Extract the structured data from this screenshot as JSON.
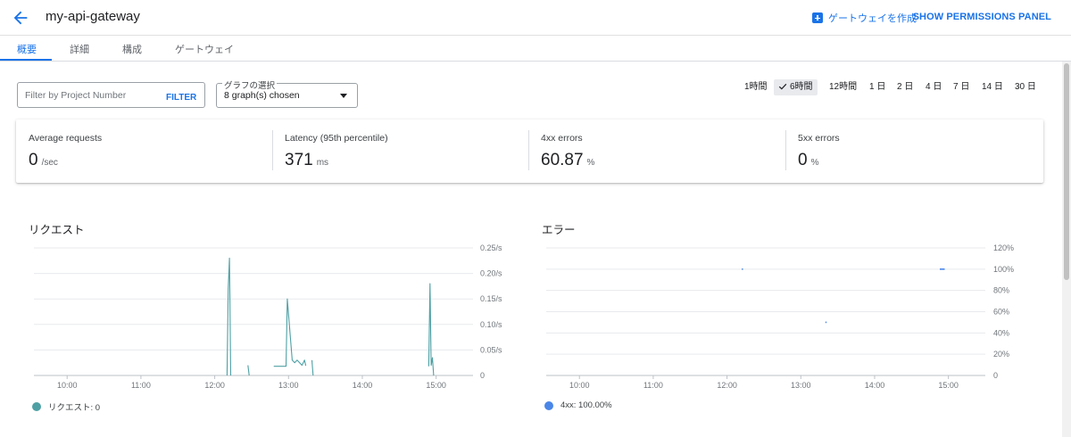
{
  "header": {
    "title": "my-api-gateway",
    "create_label": "ゲートウェイを作成",
    "permissions_label": "SHOW PERMISSIONS PANEL"
  },
  "tabs": [
    {
      "label": "概要"
    },
    {
      "label": "詳細"
    },
    {
      "label": "構成"
    },
    {
      "label": "ゲートウェイ"
    }
  ],
  "filter": {
    "placeholder": "Filter by Project Number",
    "button": "FILTER"
  },
  "graph_select": {
    "legend": "グラフの選択",
    "value": "8 graph(s) chosen"
  },
  "time_ranges": [
    {
      "label": "1時間",
      "selected": false
    },
    {
      "label": "6時間",
      "selected": true
    },
    {
      "label": "12時間",
      "selected": false
    },
    {
      "label": "1 日",
      "selected": false
    },
    {
      "label": "2 日",
      "selected": false
    },
    {
      "label": "4 日",
      "selected": false
    },
    {
      "label": "7 日",
      "selected": false
    },
    {
      "label": "14 日",
      "selected": false
    },
    {
      "label": "30 日",
      "selected": false
    }
  ],
  "metrics": [
    {
      "label": "Average requests",
      "value": "0",
      "unit": "/sec"
    },
    {
      "label": "Latency (95th percentile)",
      "value": "371",
      "unit": "ms"
    },
    {
      "label": "4xx errors",
      "value": "60.87",
      "unit": "%"
    },
    {
      "label": "5xx errors",
      "value": "0",
      "unit": "%"
    }
  ],
  "colors": {
    "accent": "#1a73e8",
    "requests_series": "#4ea0a4",
    "errors_series": "#4a86e8"
  },
  "chart_data": [
    {
      "type": "line",
      "title": "リクエスト",
      "x_ticks": [
        "10:00",
        "11:00",
        "12:00",
        "13:00",
        "14:00",
        "15:00"
      ],
      "y_ticks": [
        "0",
        "0.05/s",
        "0.10/s",
        "0.15/s",
        "0.20/s",
        "0.25/s"
      ],
      "ylim": [
        0,
        0.25
      ],
      "xlim": [
        "09:33",
        "15:30"
      ],
      "grid": true,
      "series": [
        {
          "name": "リクエスト",
          "legend_value": "0",
          "segments": [
            [
              [
                "12:10",
                0
              ],
              [
                "12:11",
                0.17
              ],
              [
                "12:12",
                0.23
              ],
              [
                "12:13",
                0
              ]
            ],
            [
              [
                "12:27",
                0.02
              ],
              [
                "12:28",
                0
              ]
            ],
            [
              [
                "12:48",
                0.018
              ],
              [
                "12:58",
                0.018
              ],
              [
                "12:59",
                0.15
              ],
              [
                "13:03",
                0.03
              ],
              [
                "13:05",
                0.025
              ],
              [
                "13:07",
                0.03
              ],
              [
                "13:09",
                0.025
              ],
              [
                "13:11",
                0.02
              ],
              [
                "13:13",
                0.03
              ],
              [
                "13:14",
                0.019
              ]
            ],
            [
              [
                "13:19",
                0.03
              ],
              [
                "13:20",
                0
              ]
            ],
            [
              [
                "14:54",
                0.018
              ],
              [
                "14:55",
                0.18
              ],
              [
                "14:56",
                0.02
              ],
              [
                "14:57",
                0.035
              ],
              [
                "14:58",
                0
              ]
            ]
          ]
        }
      ]
    },
    {
      "type": "line",
      "title": "エラー",
      "x_ticks": [
        "10:00",
        "11:00",
        "12:00",
        "13:00",
        "14:00",
        "15:00"
      ],
      "y_ticks": [
        "0",
        "20%",
        "40%",
        "60%",
        "80%",
        "100%",
        "120%"
      ],
      "ylim": [
        0,
        120
      ],
      "xlim": [
        "09:33",
        "15:30"
      ],
      "grid": true,
      "series": [
        {
          "name": "4xx",
          "legend_value": "100.00%",
          "segments": [
            [
              [
                "12:12",
                100
              ],
              [
                "12:13",
                100
              ]
            ],
            [
              [
                "13:20",
                50
              ],
              [
                "13:21",
                50
              ]
            ],
            [
              [
                "14:53",
                100
              ],
              [
                "14:57",
                100
              ]
            ]
          ]
        }
      ]
    }
  ],
  "legends": {
    "requests_text": "リクエスト: 0",
    "errors_text": "4xx:  100.00%"
  }
}
